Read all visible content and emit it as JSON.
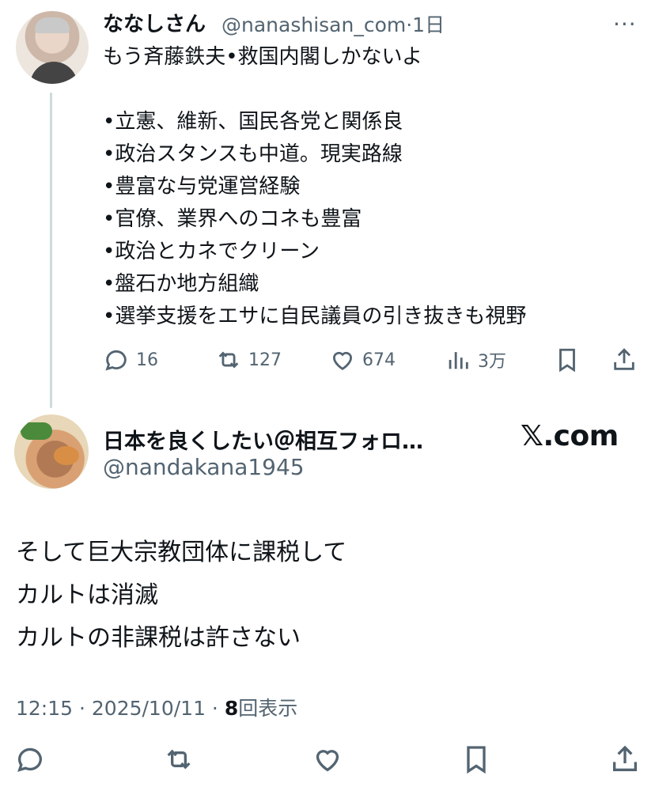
{
  "tweet1": {
    "display_name": "ななしさん",
    "handle": "@nanashisan_com",
    "time": "·1日",
    "more_icon": "more-dots-icon",
    "text": "もう斉藤鉄夫•救国内閣しかないよ\n\n•立憲、維新、国民各党と関係良\n•政治スタンスも中道。現実路線\n•豊富な与党運営経験\n•官僚、業界へのコネも豊富\n•政治とカネでクリーン\n•盤石か地方組織\n•選挙支援をエサに自民議員の引き抜きも視野",
    "replies": "16",
    "retweets": "127",
    "likes": "674",
    "views": "3万"
  },
  "tweet2": {
    "display_name": "日本を良くしたい＠相互フォロ…",
    "handle": "@nandakana1945",
    "brand": "𝕏.com",
    "text": "そして巨大宗教団体に課税して\nカルトは消滅\nカルトの非課税は許さない",
    "time": "12:15 · 2025/10/11 · ",
    "view_count": "8",
    "view_label": "回表示"
  },
  "colors": {
    "text": "#0f1419",
    "secondary": "#536471",
    "thread_line": "#cfd9de"
  }
}
